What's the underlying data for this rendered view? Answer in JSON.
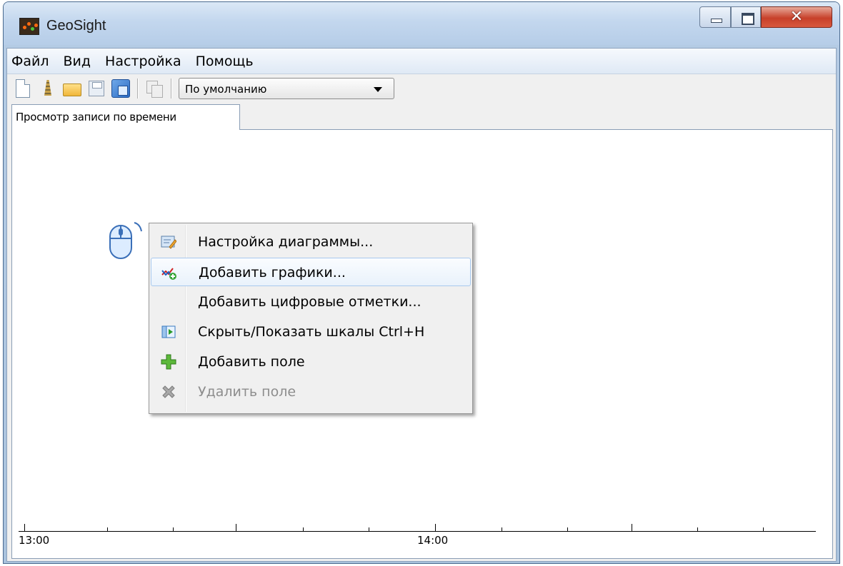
{
  "window": {
    "title": "GeoSight"
  },
  "menubar": {
    "items": [
      "Файл",
      "Вид",
      "Настройка",
      "Помощь"
    ]
  },
  "toolbar": {
    "buttons": [
      "new-file-icon",
      "tower-icon",
      "open-folder-icon",
      "save-icon",
      "save-all-icon",
      "copy-icon"
    ],
    "profile_select": {
      "value": "По умолчанию"
    }
  },
  "tabs": [
    {
      "label": "Просмотр записи по времени",
      "active": true
    }
  ],
  "context_menu": {
    "items": [
      {
        "label": "Настройка диаграммы...",
        "icon": "chart-settings-icon",
        "enabled": true,
        "highlighted": false
      },
      {
        "label": "Добавить графики...",
        "icon": "add-graphs-icon",
        "enabled": true,
        "highlighted": true
      },
      {
        "label": "Добавить цифровые отметки...",
        "icon": "",
        "enabled": true,
        "highlighted": false
      },
      {
        "label": "Скрыть/Показать шкалы Ctrl+H",
        "icon": "toggle-scales-icon",
        "enabled": true,
        "highlighted": false
      },
      {
        "label": "Добавить поле",
        "icon": "plus-icon",
        "enabled": true,
        "highlighted": false
      },
      {
        "label": "Удалить поле",
        "icon": "delete-x-icon",
        "enabled": false,
        "highlighted": false
      }
    ]
  },
  "timeline": {
    "labels": [
      "13:00",
      "14:00"
    ]
  },
  "colors": {
    "highlight_border": "#a8c9ee",
    "disabled_text": "#8d8d8d",
    "close_button": "#c7402a"
  }
}
